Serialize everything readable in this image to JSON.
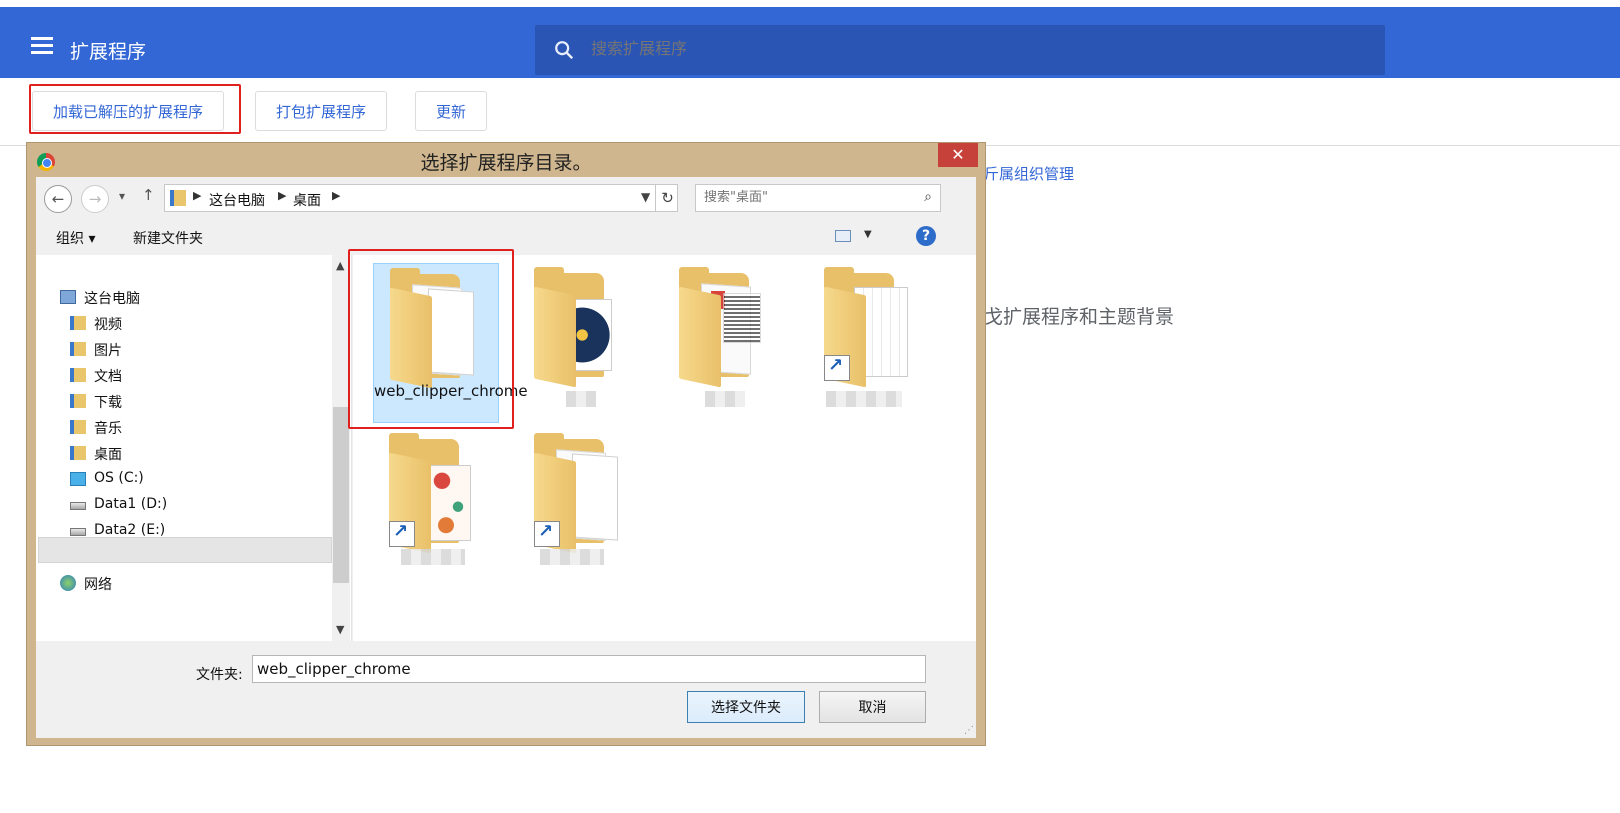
{
  "app": {
    "title": "扩展程序",
    "search_placeholder": "搜索扩展程序",
    "accent": "#3367d6"
  },
  "toolbar": {
    "load_unpacked": "加载已解压的扩展程序",
    "pack": "打包扩展程序",
    "update": "更新"
  },
  "background": {
    "org_link": "斤属组织管理",
    "empty_text": "戈扩展程序和主题背景"
  },
  "dialog": {
    "title": "选择扩展程序目录。",
    "close": "✕",
    "breadcrumb": [
      "这台电脑",
      "桌面"
    ],
    "search_placeholder": "搜索\"桌面\"",
    "commands": {
      "organize": "组织 ▾",
      "new_folder": "新建文件夹"
    },
    "tree": [
      {
        "label": "这台电脑",
        "icon": "computer-icon"
      },
      {
        "label": "视频",
        "icon": "folder-icon"
      },
      {
        "label": "图片",
        "icon": "folder-icon"
      },
      {
        "label": "文档",
        "icon": "folder-icon"
      },
      {
        "label": "下载",
        "icon": "folder-icon"
      },
      {
        "label": "音乐",
        "icon": "folder-icon"
      },
      {
        "label": "桌面",
        "icon": "folder-icon",
        "selected": true
      },
      {
        "label": "OS (C:)",
        "icon": "drive-icon"
      },
      {
        "label": "Data1 (D:)",
        "icon": "drive-icon"
      },
      {
        "label": "Data2 (E:)",
        "icon": "drive-icon"
      },
      {
        "label": "网络",
        "icon": "network-icon"
      }
    ],
    "files": [
      {
        "label": "web_clipper_chrome",
        "selected": true
      },
      {
        "label": ""
      },
      {
        "label": ""
      },
      {
        "label": ""
      },
      {
        "label": ""
      },
      {
        "label": ""
      }
    ],
    "folder_field": {
      "label": "文件夹:",
      "value": "web_clipper_chrome"
    },
    "buttons": {
      "select": "选择文件夹",
      "cancel": "取消"
    }
  }
}
